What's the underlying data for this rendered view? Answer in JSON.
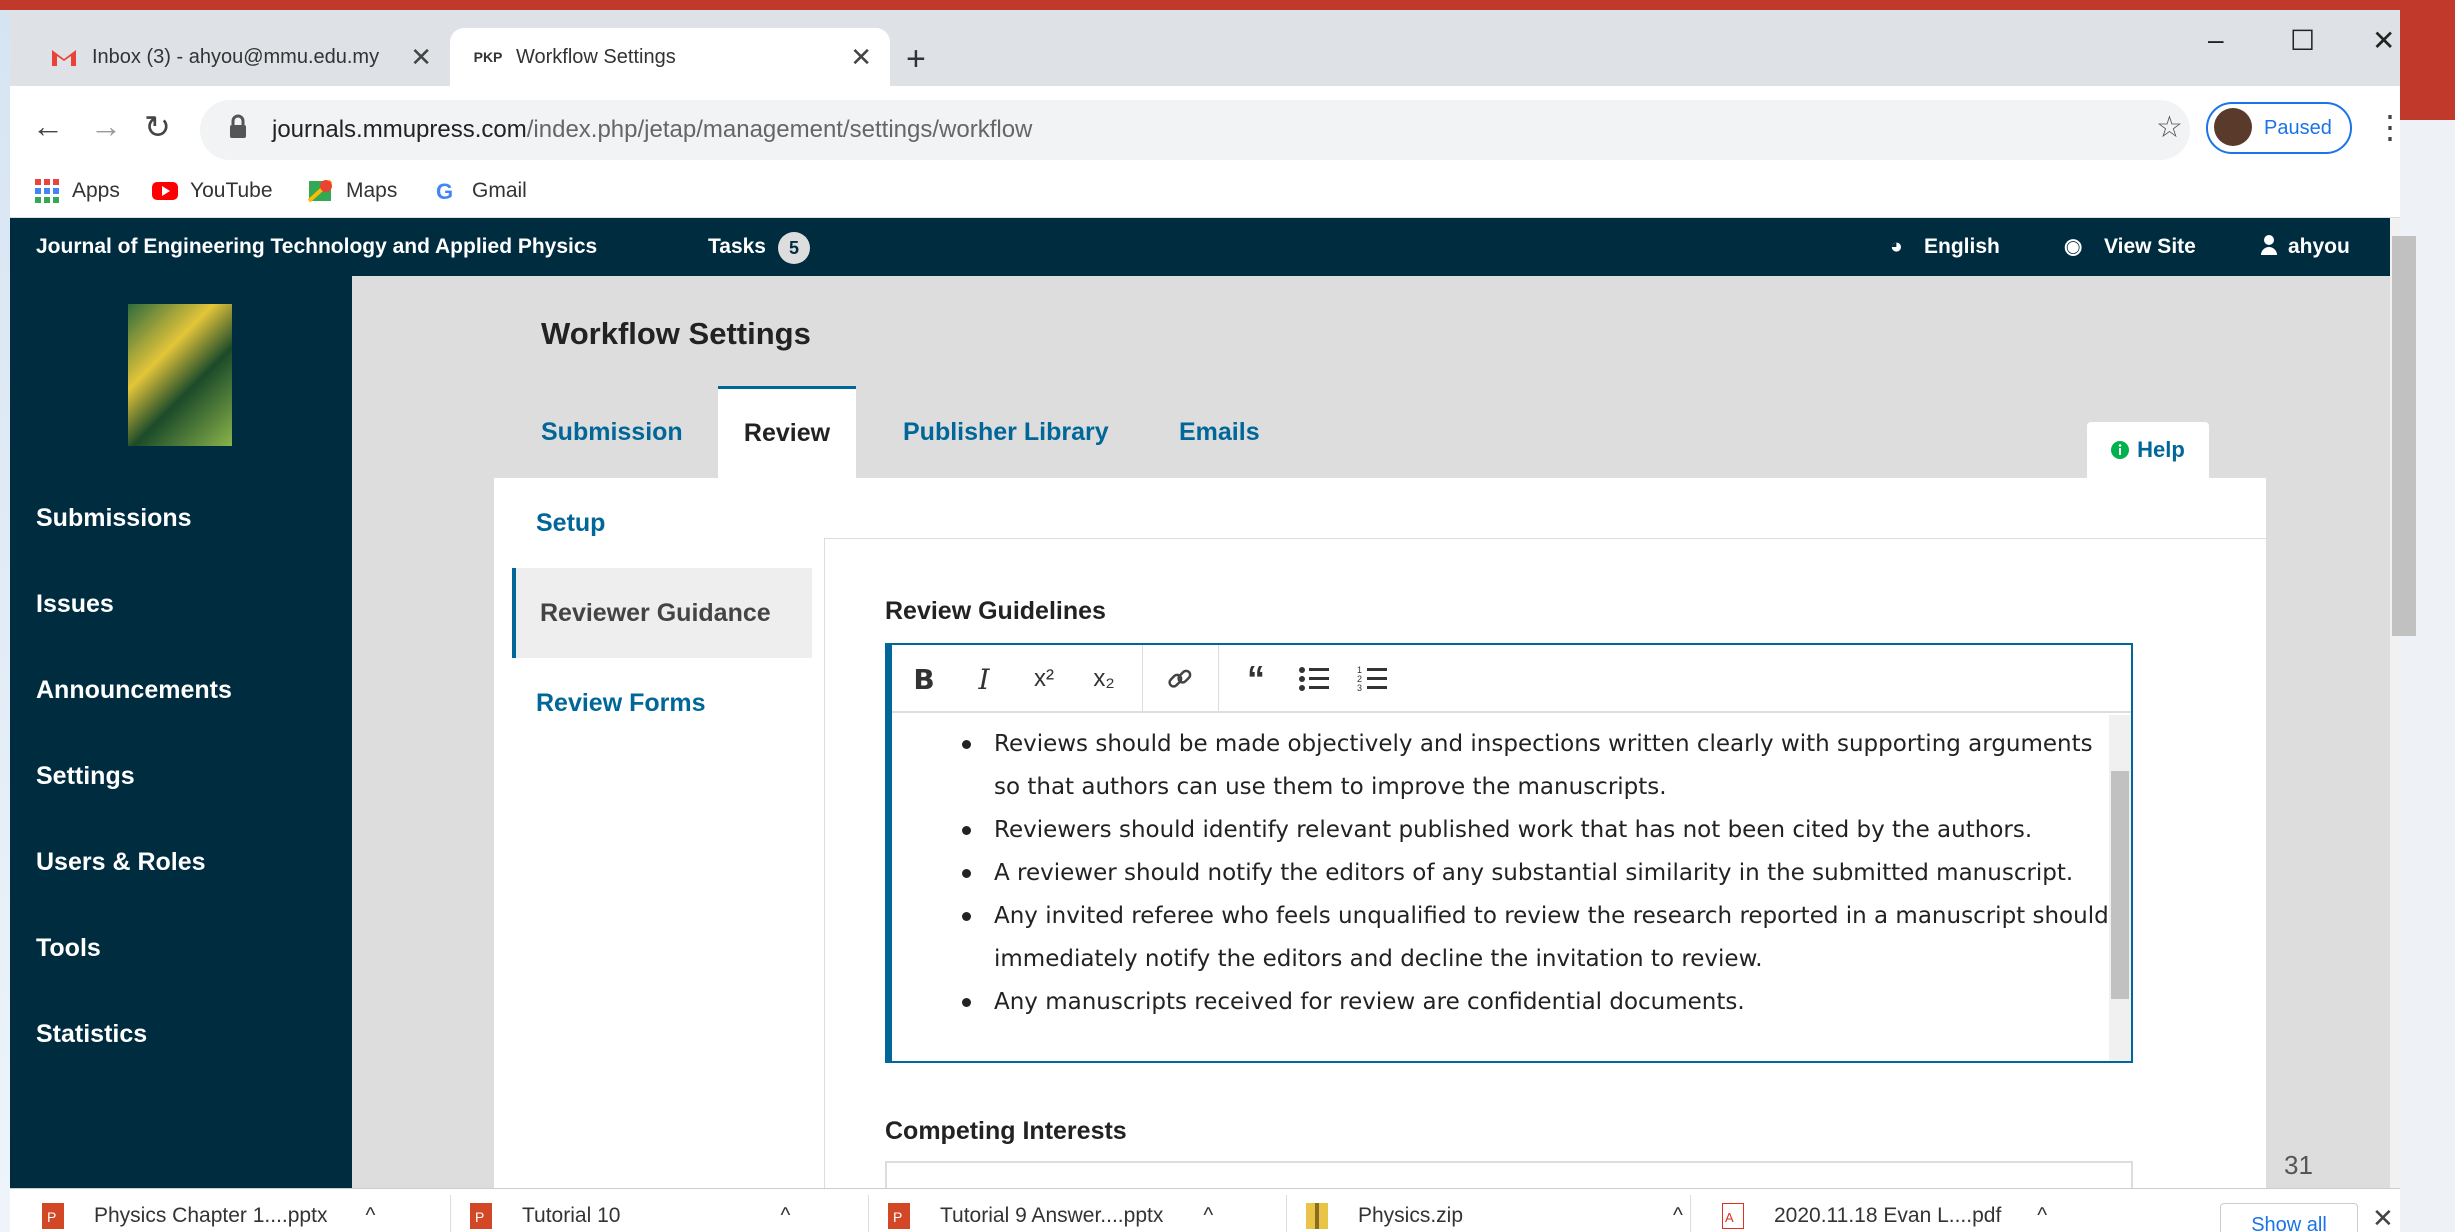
{
  "browser": {
    "tabs": [
      {
        "label": "Inbox (3) - ahyou@mmu.edu.my",
        "icon": "gmail-icon"
      },
      {
        "label": "Workflow Settings",
        "favicon_text": "PKP"
      }
    ],
    "url_host": "journals.mmupress.com",
    "url_path": "/index.php/jetap/management/settings/workflow",
    "profile_status": "Paused",
    "bookmarks": [
      "Apps",
      "YouTube",
      "Maps",
      "Gmail"
    ]
  },
  "topbar": {
    "journal_name": "Journal of Engineering Technology and Applied Physics",
    "tasks_label": "Tasks",
    "tasks_count": "5",
    "language": "English",
    "view_site": "View Site",
    "user": "ahyou"
  },
  "sidebar": {
    "items": [
      "Submissions",
      "Issues",
      "Announcements",
      "Settings",
      "Users & Roles",
      "Tools",
      "Statistics"
    ]
  },
  "main": {
    "title": "Workflow Settings",
    "tabs": [
      "Submission",
      "Review",
      "Publisher Library",
      "Emails"
    ],
    "active_tab": "Review",
    "help_label": "Help",
    "subtabs": [
      "Setup",
      "Reviewer Guidance",
      "Review Forms"
    ],
    "active_subtab": "Reviewer Guidance",
    "review_guidelines_label": "Review Guidelines",
    "guidelines": [
      "Reviews should be made objectively and inspections written clearly with supporting arguments so that authors can use them to improve the manuscripts.",
      "Reviewers should identify relevant published work that has not been cited by the authors.",
      "A reviewer should notify the editors of any substantial similarity in the submitted manuscript.",
      "Any invited referee who feels unqualified to review the research reported in a manuscript should immediately notify the editors and decline the invitation to review.",
      "Any manuscripts received for review are confidential documents."
    ],
    "competing_interests_label": "Competing Interests"
  },
  "downloads": {
    "items": [
      "Physics Chapter 1....pptx",
      "Tutorial 10",
      "Tutorial 9 Answer....pptx",
      "Physics.zip",
      "2020.11.18 Evan L....pdf"
    ],
    "show_all": "Show all"
  },
  "slide_page_number": "31",
  "colors": {
    "nav_dark": "#002c40",
    "link_blue": "#006798",
    "chrome_accent": "#1a73e8",
    "frame_red": "#c0392b"
  }
}
